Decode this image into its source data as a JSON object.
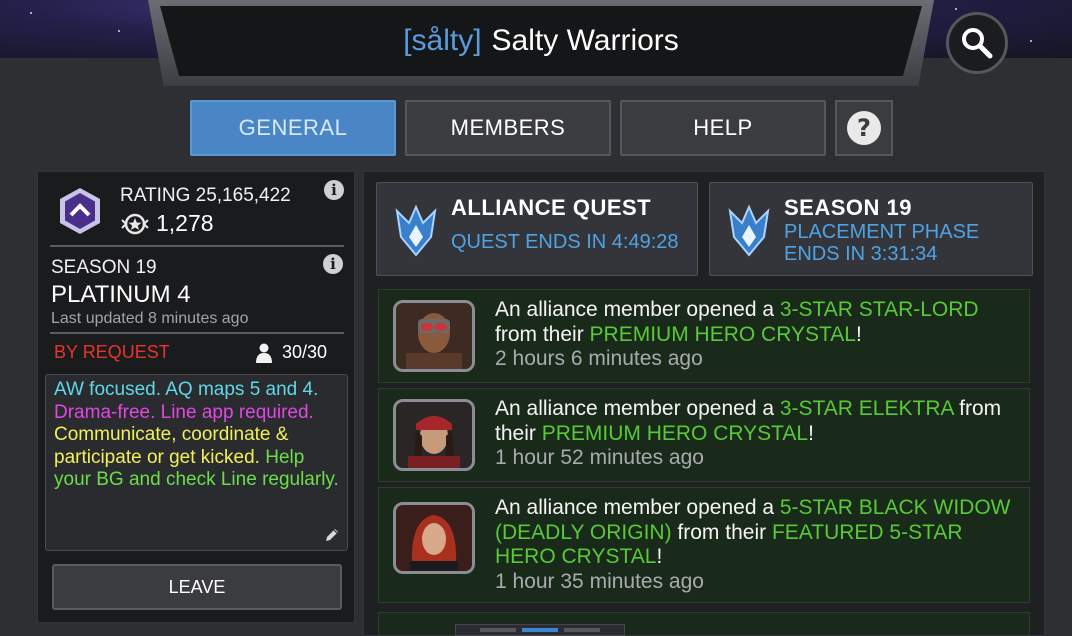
{
  "header": {
    "alliance_tag": "[sålty]",
    "alliance_name": "Salty Warriors"
  },
  "tabs": [
    {
      "label": "GENERAL",
      "active": true
    },
    {
      "label": "MEMBERS",
      "active": false
    },
    {
      "label": "HELP",
      "active": false
    }
  ],
  "overview": {
    "rating_label": "RATING 25,165,422",
    "points": "1,278",
    "season_label": "SEASON 19",
    "tier": "PLATINUM 4",
    "last_updated": "Last updated 8 minutes ago",
    "join_type": "BY REQUEST",
    "member_count": "30/30",
    "description": {
      "part1": "AW focused. AQ maps 5 and 4.",
      "part2": " Drama-free. Line app required.",
      "part3": "  Communicate, coordinate & participate or get kicked.",
      "part4": " Help your BG and check Line regularly."
    },
    "leave_label": "LEAVE"
  },
  "events": [
    {
      "title": "ALLIANCE QUEST",
      "subtitle": "QUEST ENDS IN 4:49:28"
    },
    {
      "title": "SEASON 19",
      "subtitle_line1": "PLACEMENT PHASE",
      "subtitle_line2": "ENDS IN 3:31:34"
    }
  ],
  "feed": [
    {
      "prefix": "An alliance member opened a ",
      "champion": "3-STAR STAR-LORD",
      "middle": " from their ",
      "crystal": "PREMIUM HERO CRYSTAL",
      "suffix": "!",
      "time": "2 hours 6 minutes ago"
    },
    {
      "prefix": "An alliance member opened a ",
      "champion": "3-STAR ELEKTRA",
      "middle": " from their ",
      "crystal": "PREMIUM HERO CRYSTAL",
      "suffix": "!",
      "time": "1 hour 52 minutes ago"
    },
    {
      "prefix": "An alliance member opened a ",
      "champion": "5-STAR BLACK WIDOW (DEADLY ORIGIN)",
      "middle": " from their ",
      "crystal": "FEATURED 5-STAR HERO CRYSTAL",
      "suffix": "!",
      "time": "1 hour 35 minutes ago"
    }
  ],
  "colors": {
    "accent": "#4a86c5",
    "quest_blue": "#4fa3e3",
    "highlight_green": "#58c937",
    "request_red": "#e8352b"
  },
  "icons": [
    "search-icon",
    "help-icon",
    "info-icon",
    "rating-emblem-icon",
    "alliance-points-icon",
    "member-icon",
    "edit-icon",
    "alliance-quest-icon",
    "season-icon"
  ]
}
